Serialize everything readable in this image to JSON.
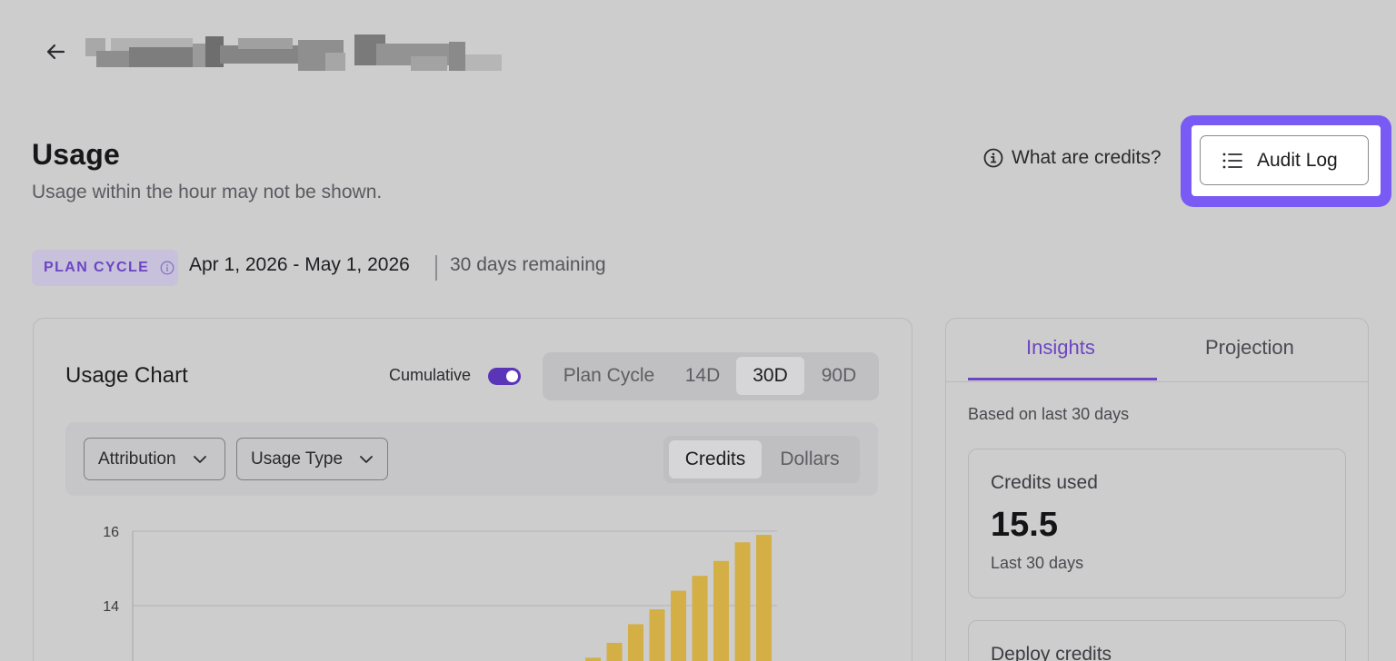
{
  "header": {
    "back_icon": "arrow-left-icon",
    "title_redacted": true
  },
  "page": {
    "title": "Usage",
    "subtitle": "Usage within the hour may not be shown."
  },
  "help_link": {
    "label": "What are credits?",
    "icon": "info-icon"
  },
  "audit_button": {
    "label": "Audit Log",
    "icon": "list-icon",
    "highlighted": true,
    "highlight_color": "#7a5af5"
  },
  "plan_cycle": {
    "badge": "PLAN CYCLE",
    "badge_icon": "info-icon",
    "dates": "Apr 1, 2026 - May 1, 2026",
    "remaining": "30 days remaining"
  },
  "usage_chart": {
    "title": "Usage Chart",
    "cumulative_label": "Cumulative",
    "cumulative_on": true,
    "ranges": [
      "Plan Cycle",
      "14D",
      "30D",
      "90D"
    ],
    "active_range": "30D",
    "filters": [
      {
        "label": "Attribution",
        "icon": "chevron-down-icon"
      },
      {
        "label": "Usage Type",
        "icon": "chevron-down-icon"
      }
    ],
    "units": [
      "Credits",
      "Dollars"
    ],
    "active_unit": "Credits"
  },
  "chart_data": {
    "type": "bar",
    "title": "",
    "xlabel": "",
    "ylabel": "",
    "y_ticks": [
      14,
      16
    ],
    "visible_ylim": [
      12.5,
      16
    ],
    "bar_color": "#d4af45",
    "values": [
      12.6,
      13.0,
      13.5,
      13.9,
      14.4,
      14.8,
      15.2,
      15.7,
      15.9
    ]
  },
  "insights": {
    "tabs": [
      "Insights",
      "Projection"
    ],
    "active_tab": "Insights",
    "based_on": "Based on last 30 days",
    "cards": [
      {
        "label": "Credits used",
        "value": "15.5",
        "period": "Last 30 days"
      },
      {
        "label": "Deploy credits"
      }
    ]
  },
  "colors": {
    "accent": "#6c45c4",
    "background": "#cdcdcd"
  }
}
